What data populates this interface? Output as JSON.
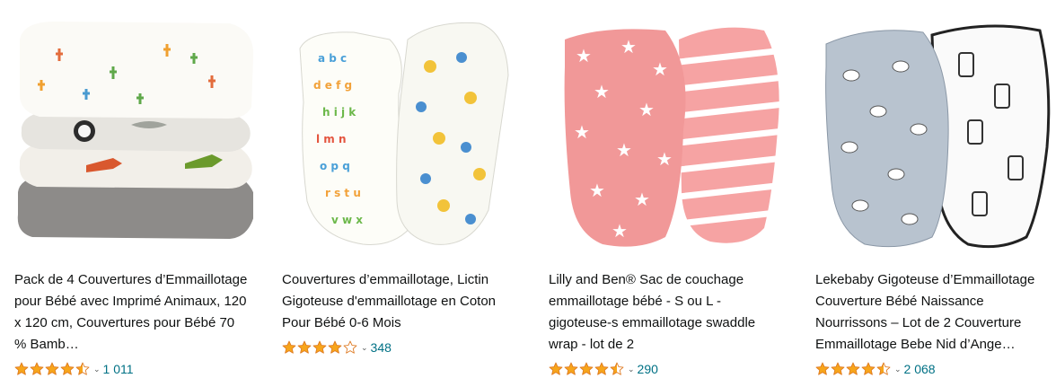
{
  "colors": {
    "star": "#F7A51B",
    "link": "#007185",
    "text": "#0F1111"
  },
  "products": [
    {
      "title": "Pack de 4 Couvertures d’Emmaillotage pour Bébé avec Imprimé Animaux, 120 x 120 cm, Couvertures pour Bébé 70 % Bamb…",
      "rating": 4.5,
      "review_count": "1 011"
    },
    {
      "title": "Couvertures d’emmaillotage, Lictin Gigoteuse d'emmaillotage en Coton Pour Bébé 0-6 Mois",
      "rating": 4.0,
      "review_count": "348"
    },
    {
      "title": "Lilly and Ben® Sac de couchage emmaillotage bébé - S ou L - gigoteuse-s emmaillotage swaddle wrap - lot de 2",
      "rating": 4.5,
      "review_count": "290"
    },
    {
      "title": "Lekebaby Gigoteuse d’Emmaillotage Couverture Bébé Naissance Nourrissons – Lot de 2 Couverture Emmaillotage Bebe Nid d’Ange…",
      "rating": 4.5,
      "review_count": "2 068"
    }
  ]
}
